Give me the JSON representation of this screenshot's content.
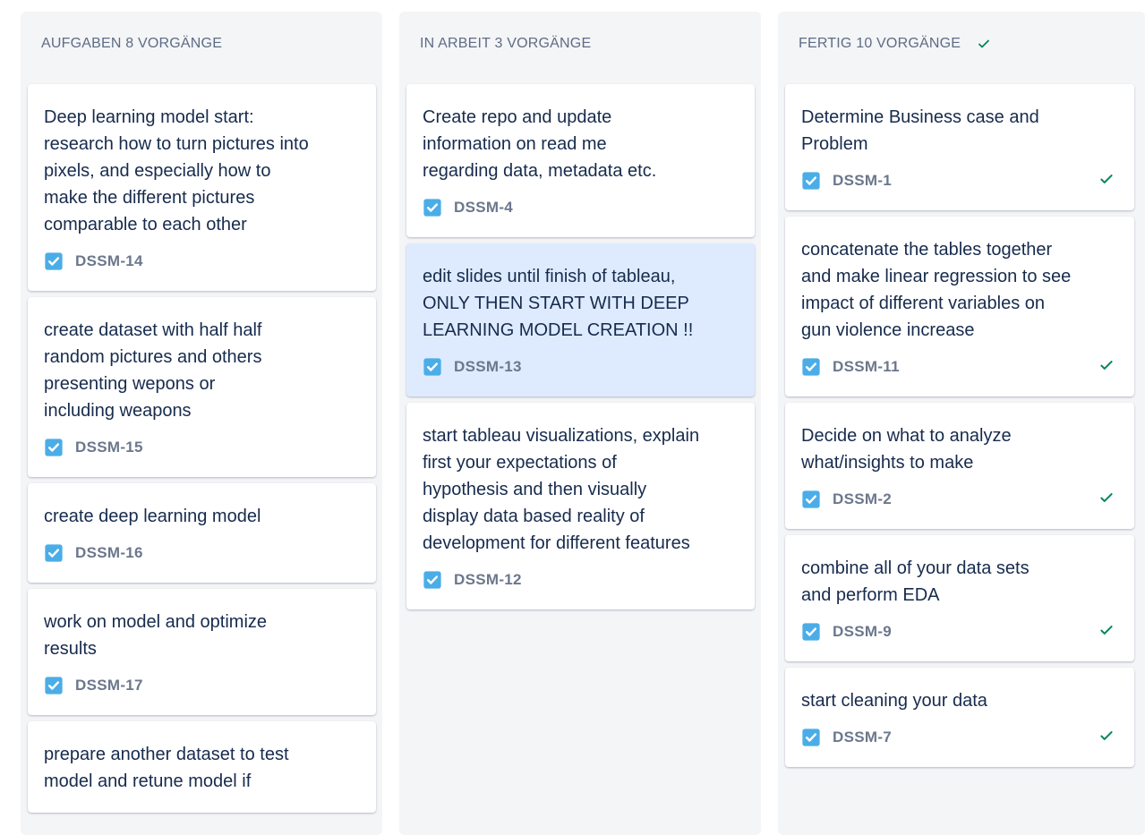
{
  "colors": {
    "accent_blue": "#4bade8",
    "done_green": "#00875a",
    "selected_card": "#deebff"
  },
  "columns": [
    {
      "title": "AUFGABEN 8 VORGÄNGE",
      "cards": [
        {
          "summary": "Deep learning model start: research how to turn pictures into pixels, and especially how to make the different pictures comparable to each other",
          "key": "DSSM-14",
          "type_icon": "task-checkbox-icon"
        },
        {
          "summary": "create dataset with half half random pictures and others presenting wepons or including weapons",
          "key": "DSSM-15",
          "type_icon": "task-checkbox-icon"
        },
        {
          "summary": "create deep learning model",
          "key": "DSSM-16",
          "type_icon": "task-checkbox-icon"
        },
        {
          "summary": "work on model and optimize results",
          "key": "DSSM-17",
          "type_icon": "task-checkbox-icon"
        },
        {
          "summary": "prepare another dataset to test model and retune model if",
          "key": "",
          "type_icon": "task-checkbox-icon"
        }
      ]
    },
    {
      "title": "IN ARBEIT 3 VORGÄNGE",
      "cards": [
        {
          "summary": "Create repo and update information on read me regarding data, metadata etc.",
          "key": "DSSM-4",
          "type_icon": "task-checkbox-icon"
        },
        {
          "summary": "edit slides until finish of tableau, ONLY THEN START WITH DEEP LEARNING MODEL CREATION !!",
          "key": "DSSM-13",
          "type_icon": "task-checkbox-icon",
          "selected": true
        },
        {
          "summary": "start tableau visualizations, explain first your expectations of hypothesis and then visually display data based reality of development for different features",
          "key": "DSSM-12",
          "type_icon": "task-checkbox-icon"
        }
      ]
    },
    {
      "title": "FERTIG 10 VORGÄNGE",
      "header_icon": "check-icon",
      "cards": [
        {
          "summary": "Determine Business case and Problem",
          "key": "DSSM-1",
          "type_icon": "task-checkbox-icon",
          "done": true
        },
        {
          "summary": "concatenate the tables together and make linear regression to see impact of different variables on gun violence increase",
          "key": "DSSM-11",
          "type_icon": "task-checkbox-icon",
          "done": true
        },
        {
          "summary": "Decide on what to analyze what/insights to make",
          "key": "DSSM-2",
          "type_icon": "task-checkbox-icon",
          "done": true
        },
        {
          "summary": "combine all of your data sets and perform EDA",
          "key": "DSSM-9",
          "type_icon": "task-checkbox-icon",
          "done": true
        },
        {
          "summary": "start cleaning your data",
          "key": "DSSM-7",
          "type_icon": "task-checkbox-icon",
          "done": true
        }
      ]
    }
  ]
}
